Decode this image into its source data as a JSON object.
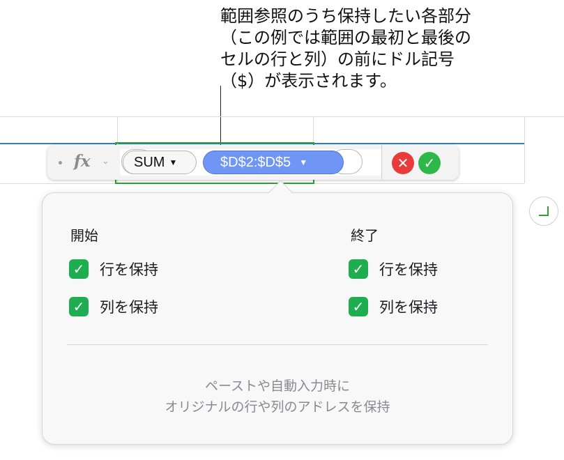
{
  "callout": {
    "text": "範囲参照のうち保持したい各部分\n（この例では範囲の最初と最後の\nセルの行と列）の前にドル記号\n（$）が表示されます。"
  },
  "formula_bar": {
    "fx_label": "fx",
    "function_token": "SUM",
    "range_token": "$D$2:$D$5",
    "cancel_icon": "close-icon",
    "accept_icon": "checkmark-icon"
  },
  "popover": {
    "start": {
      "heading": "開始",
      "options": [
        {
          "label": "行を保持",
          "checked": true
        },
        {
          "label": "列を保持",
          "checked": true
        }
      ]
    },
    "end": {
      "heading": "終了",
      "options": [
        {
          "label": "行を保持",
          "checked": true
        },
        {
          "label": "列を保持",
          "checked": true
        }
      ]
    },
    "footnote": "ペーストや自動入力時に\nオリジナルの行や列のアドレスを保持"
  },
  "colors": {
    "range_token": "#6f96f4",
    "checkbox": "#1fae4f",
    "cancel": "#ea3b3b",
    "accept": "#2fb84a",
    "selection": "#2f9d3a"
  }
}
